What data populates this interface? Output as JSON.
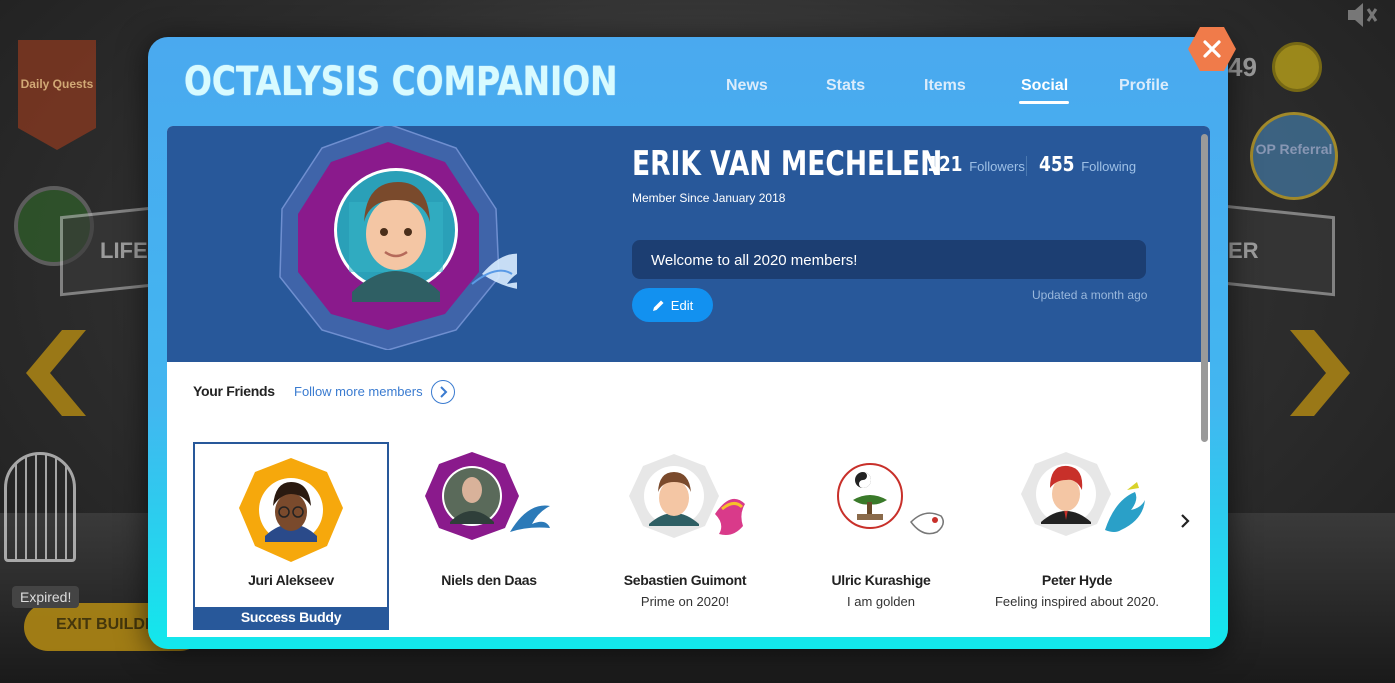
{
  "background": {
    "banner_label": "Daily Quests",
    "left_panel_label": "LIFE",
    "right_panel_label": "ER",
    "coin_count": "49",
    "referral_label": "OP Referral",
    "expired_label": "Expired!",
    "exit_button_label": "EXIT BUILDIN"
  },
  "modal": {
    "title": "OCTALYSIS COMPANION",
    "nav": [
      {
        "label": "News",
        "active": false
      },
      {
        "label": "Stats",
        "active": false
      },
      {
        "label": "Items",
        "active": false
      },
      {
        "label": "Social",
        "active": true
      },
      {
        "label": "Profile",
        "active": false
      }
    ],
    "accent_color": "#28589a"
  },
  "profile": {
    "name": "ERIK VAN MECHELEN",
    "member_since": "Member Since January 2018",
    "followers_count": "121",
    "followers_label": "Followers",
    "following_count": "455",
    "following_label": "Following",
    "status_message": "Welcome to all 2020 members!",
    "edit_label": "Edit",
    "updated_label": "Updated a month ago"
  },
  "friends": {
    "section_title": "Your Friends",
    "follow_more_label": "Follow more members",
    "items": [
      {
        "name": "Juri Alekseev",
        "status": "",
        "badge": "Success Buddy",
        "frame_color": "#f6a80c"
      },
      {
        "name": "Niels den Daas",
        "status": "",
        "badge": "",
        "frame_color": "#8a1a8c"
      },
      {
        "name": "Sebastien Guimont",
        "status": "Prime on 2020!",
        "badge": "",
        "frame_color": "#e7e7e7"
      },
      {
        "name": "Ulric Kurashige",
        "status": "I am golden",
        "badge": "",
        "frame_color": "#ffffff"
      },
      {
        "name": "Peter Hyde",
        "status": "Feeling inspired about 2020.",
        "badge": "",
        "frame_color": "#e7e7e7"
      }
    ]
  }
}
